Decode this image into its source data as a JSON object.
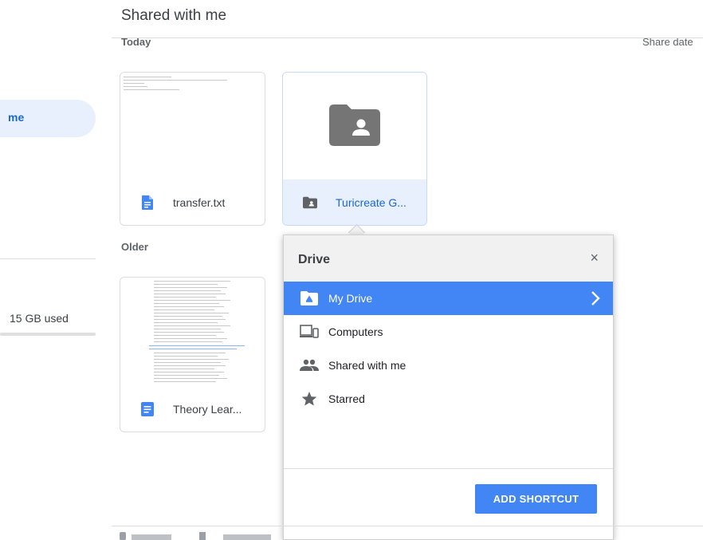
{
  "header": {
    "title": "Shared with me",
    "sort_label": "Share date"
  },
  "sections": {
    "today": "Today",
    "older": "Older"
  },
  "sidebar": {
    "active_item_label": "me",
    "storage_text": "15 GB used"
  },
  "files": [
    {
      "name": "transfer.txt",
      "icon": "text-file-icon",
      "section": "today"
    },
    {
      "name": "Turicreate G...",
      "icon": "shared-folder-icon",
      "section": "today",
      "selected": true
    },
    {
      "name": "Theory Lear...",
      "icon": "google-doc-icon",
      "section": "older"
    }
  ],
  "dialog": {
    "title": "Drive",
    "close_label": "×",
    "items": [
      {
        "label": "My Drive",
        "icon": "my-drive-icon",
        "active": true
      },
      {
        "label": "Computers",
        "icon": "computers-icon"
      },
      {
        "label": "Shared with me",
        "icon": "shared-people-icon"
      },
      {
        "label": "Starred",
        "icon": "star-icon"
      }
    ],
    "action_label": "ADD SHORTCUT"
  },
  "colors": {
    "accent": "#4285f4",
    "selected_bg": "#e8f0fe",
    "selected_text": "#1967d2",
    "doc_blue": "#4285f4"
  }
}
